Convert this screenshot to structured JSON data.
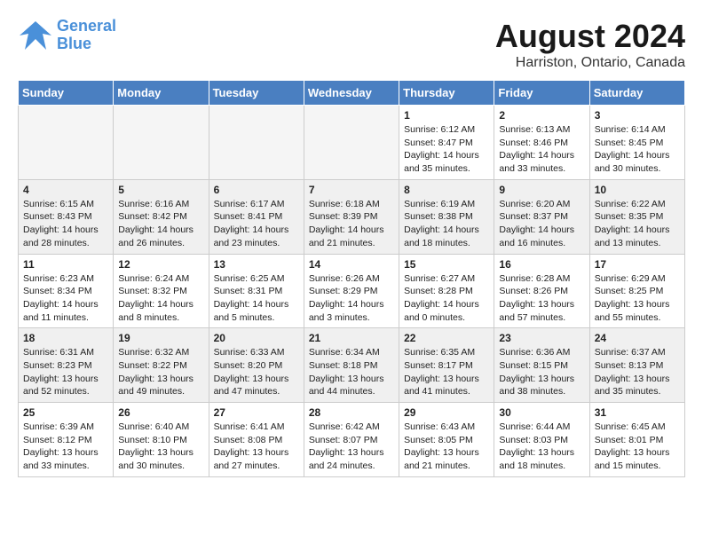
{
  "header": {
    "logo_general": "General",
    "logo_blue": "Blue",
    "month_year": "August 2024",
    "location": "Harriston, Ontario, Canada"
  },
  "days_of_week": [
    "Sunday",
    "Monday",
    "Tuesday",
    "Wednesday",
    "Thursday",
    "Friday",
    "Saturday"
  ],
  "weeks": [
    [
      {
        "day": "",
        "empty": true
      },
      {
        "day": "",
        "empty": true
      },
      {
        "day": "",
        "empty": true
      },
      {
        "day": "",
        "empty": true
      },
      {
        "day": "1",
        "sunrise": "Sunrise: 6:12 AM",
        "sunset": "Sunset: 8:47 PM",
        "daylight": "Daylight: 14 hours and 35 minutes."
      },
      {
        "day": "2",
        "sunrise": "Sunrise: 6:13 AM",
        "sunset": "Sunset: 8:46 PM",
        "daylight": "Daylight: 14 hours and 33 minutes."
      },
      {
        "day": "3",
        "sunrise": "Sunrise: 6:14 AM",
        "sunset": "Sunset: 8:45 PM",
        "daylight": "Daylight: 14 hours and 30 minutes."
      }
    ],
    [
      {
        "day": "4",
        "sunrise": "Sunrise: 6:15 AM",
        "sunset": "Sunset: 8:43 PM",
        "daylight": "Daylight: 14 hours and 28 minutes."
      },
      {
        "day": "5",
        "sunrise": "Sunrise: 6:16 AM",
        "sunset": "Sunset: 8:42 PM",
        "daylight": "Daylight: 14 hours and 26 minutes."
      },
      {
        "day": "6",
        "sunrise": "Sunrise: 6:17 AM",
        "sunset": "Sunset: 8:41 PM",
        "daylight": "Daylight: 14 hours and 23 minutes."
      },
      {
        "day": "7",
        "sunrise": "Sunrise: 6:18 AM",
        "sunset": "Sunset: 8:39 PM",
        "daylight": "Daylight: 14 hours and 21 minutes."
      },
      {
        "day": "8",
        "sunrise": "Sunrise: 6:19 AM",
        "sunset": "Sunset: 8:38 PM",
        "daylight": "Daylight: 14 hours and 18 minutes."
      },
      {
        "day": "9",
        "sunrise": "Sunrise: 6:20 AM",
        "sunset": "Sunset: 8:37 PM",
        "daylight": "Daylight: 14 hours and 16 minutes."
      },
      {
        "day": "10",
        "sunrise": "Sunrise: 6:22 AM",
        "sunset": "Sunset: 8:35 PM",
        "daylight": "Daylight: 14 hours and 13 minutes."
      }
    ],
    [
      {
        "day": "11",
        "sunrise": "Sunrise: 6:23 AM",
        "sunset": "Sunset: 8:34 PM",
        "daylight": "Daylight: 14 hours and 11 minutes."
      },
      {
        "day": "12",
        "sunrise": "Sunrise: 6:24 AM",
        "sunset": "Sunset: 8:32 PM",
        "daylight": "Daylight: 14 hours and 8 minutes."
      },
      {
        "day": "13",
        "sunrise": "Sunrise: 6:25 AM",
        "sunset": "Sunset: 8:31 PM",
        "daylight": "Daylight: 14 hours and 5 minutes."
      },
      {
        "day": "14",
        "sunrise": "Sunrise: 6:26 AM",
        "sunset": "Sunset: 8:29 PM",
        "daylight": "Daylight: 14 hours and 3 minutes."
      },
      {
        "day": "15",
        "sunrise": "Sunrise: 6:27 AM",
        "sunset": "Sunset: 8:28 PM",
        "daylight": "Daylight: 14 hours and 0 minutes."
      },
      {
        "day": "16",
        "sunrise": "Sunrise: 6:28 AM",
        "sunset": "Sunset: 8:26 PM",
        "daylight": "Daylight: 13 hours and 57 minutes."
      },
      {
        "day": "17",
        "sunrise": "Sunrise: 6:29 AM",
        "sunset": "Sunset: 8:25 PM",
        "daylight": "Daylight: 13 hours and 55 minutes."
      }
    ],
    [
      {
        "day": "18",
        "sunrise": "Sunrise: 6:31 AM",
        "sunset": "Sunset: 8:23 PM",
        "daylight": "Daylight: 13 hours and 52 minutes."
      },
      {
        "day": "19",
        "sunrise": "Sunrise: 6:32 AM",
        "sunset": "Sunset: 8:22 PM",
        "daylight": "Daylight: 13 hours and 49 minutes."
      },
      {
        "day": "20",
        "sunrise": "Sunrise: 6:33 AM",
        "sunset": "Sunset: 8:20 PM",
        "daylight": "Daylight: 13 hours and 47 minutes."
      },
      {
        "day": "21",
        "sunrise": "Sunrise: 6:34 AM",
        "sunset": "Sunset: 8:18 PM",
        "daylight": "Daylight: 13 hours and 44 minutes."
      },
      {
        "day": "22",
        "sunrise": "Sunrise: 6:35 AM",
        "sunset": "Sunset: 8:17 PM",
        "daylight": "Daylight: 13 hours and 41 minutes."
      },
      {
        "day": "23",
        "sunrise": "Sunrise: 6:36 AM",
        "sunset": "Sunset: 8:15 PM",
        "daylight": "Daylight: 13 hours and 38 minutes."
      },
      {
        "day": "24",
        "sunrise": "Sunrise: 6:37 AM",
        "sunset": "Sunset: 8:13 PM",
        "daylight": "Daylight: 13 hours and 35 minutes."
      }
    ],
    [
      {
        "day": "25",
        "sunrise": "Sunrise: 6:39 AM",
        "sunset": "Sunset: 8:12 PM",
        "daylight": "Daylight: 13 hours and 33 minutes."
      },
      {
        "day": "26",
        "sunrise": "Sunrise: 6:40 AM",
        "sunset": "Sunset: 8:10 PM",
        "daylight": "Daylight: 13 hours and 30 minutes."
      },
      {
        "day": "27",
        "sunrise": "Sunrise: 6:41 AM",
        "sunset": "Sunset: 8:08 PM",
        "daylight": "Daylight: 13 hours and 27 minutes."
      },
      {
        "day": "28",
        "sunrise": "Sunrise: 6:42 AM",
        "sunset": "Sunset: 8:07 PM",
        "daylight": "Daylight: 13 hours and 24 minutes."
      },
      {
        "day": "29",
        "sunrise": "Sunrise: 6:43 AM",
        "sunset": "Sunset: 8:05 PM",
        "daylight": "Daylight: 13 hours and 21 minutes."
      },
      {
        "day": "30",
        "sunrise": "Sunrise: 6:44 AM",
        "sunset": "Sunset: 8:03 PM",
        "daylight": "Daylight: 13 hours and 18 minutes."
      },
      {
        "day": "31",
        "sunrise": "Sunrise: 6:45 AM",
        "sunset": "Sunset: 8:01 PM",
        "daylight": "Daylight: 13 hours and 15 minutes."
      }
    ]
  ]
}
